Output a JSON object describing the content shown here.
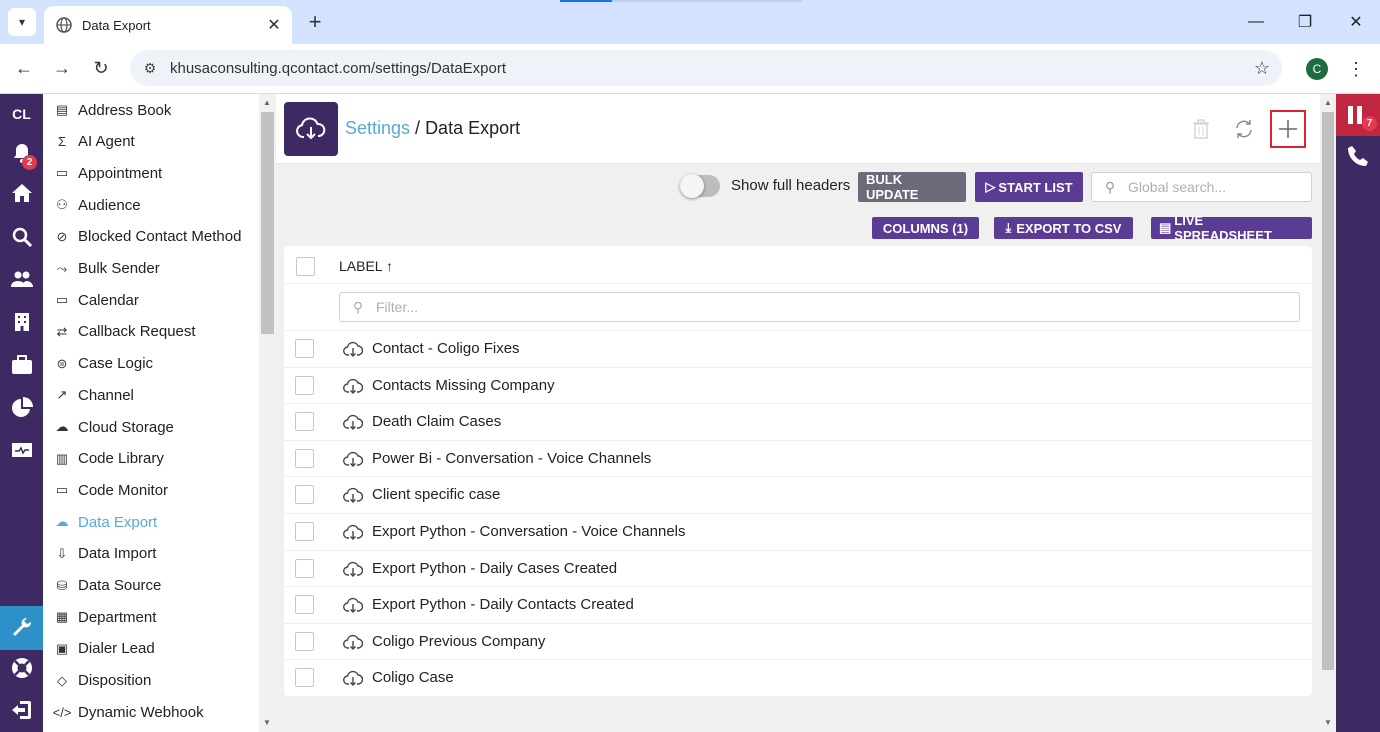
{
  "browser": {
    "tab_title": "Data Export",
    "url": "khusaconsulting.qcontact.com/settings/DataExport",
    "profile_initial": "C"
  },
  "rail": {
    "logo": "CL",
    "notification_count": "2",
    "items": [
      "bell-icon",
      "home-icon",
      "search-icon",
      "users-icon",
      "building-icon",
      "briefcase-icon",
      "pie-chart-icon",
      "monitor-icon",
      "wrench-icon",
      "lifebuoy-icon",
      "logout-icon"
    ]
  },
  "right_rail": {
    "queue_count": "7"
  },
  "menu": {
    "items": [
      {
        "label": "Address Book",
        "icon": "contact-card-icon",
        "glyph": "▤"
      },
      {
        "label": "AI Agent",
        "icon": "sigma-icon",
        "glyph": "Σ"
      },
      {
        "label": "Appointment",
        "icon": "calendar-icon",
        "glyph": "▭"
      },
      {
        "label": "Audience",
        "icon": "group-icon",
        "glyph": "⚇"
      },
      {
        "label": "Blocked Contact Method",
        "icon": "blocked-icon",
        "glyph": "⊘"
      },
      {
        "label": "Bulk Sender",
        "icon": "bulk-send-icon",
        "glyph": "⤳"
      },
      {
        "label": "Calendar",
        "icon": "calendar-icon",
        "glyph": "▭"
      },
      {
        "label": "Callback Request",
        "icon": "repeat-icon",
        "glyph": "⇄"
      },
      {
        "label": "Case Logic",
        "icon": "logic-icon",
        "glyph": "⊜"
      },
      {
        "label": "Channel",
        "icon": "external-link-icon",
        "glyph": "↗"
      },
      {
        "label": "Cloud Storage",
        "icon": "cloud-upload-icon",
        "glyph": "☁"
      },
      {
        "label": "Code Library",
        "icon": "books-icon",
        "glyph": "▥"
      },
      {
        "label": "Code Monitor",
        "icon": "code-monitor-icon",
        "glyph": "▭"
      },
      {
        "label": "Data Export",
        "icon": "cloud-download-icon",
        "glyph": "☁"
      },
      {
        "label": "Data Import",
        "icon": "import-icon",
        "glyph": "⇩"
      },
      {
        "label": "Data Source",
        "icon": "database-icon",
        "glyph": "⛁"
      },
      {
        "label": "Department",
        "icon": "building-icon",
        "glyph": "▦"
      },
      {
        "label": "Dialer Lead",
        "icon": "dialer-icon",
        "glyph": "▣"
      },
      {
        "label": "Disposition",
        "icon": "tag-icon",
        "glyph": "◇"
      },
      {
        "label": "Dynamic Webhook",
        "icon": "code-icon",
        "glyph": "</>"
      }
    ],
    "current": "Data Export"
  },
  "header": {
    "crumb_link": "Settings",
    "crumb_sep": " / ",
    "crumb_current": "Data Export"
  },
  "controls": {
    "toggle_label": "Show full headers",
    "bulk_update": "BULK UPDATE",
    "start_list": "START LIST",
    "search_placeholder": "Global search...",
    "columns": "COLUMNS (1)",
    "export_csv": "EXPORT TO CSV",
    "live_spreadsheet": "LIVE SPREADSHEET"
  },
  "table": {
    "column_label": "LABEL",
    "sort": "ascending",
    "filter_placeholder": "Filter...",
    "rows": [
      "Contact - Coligo Fixes",
      "Contacts Missing Company",
      "Death Claim Cases",
      "Power Bi - Conversation - Voice Channels",
      "Client specific case",
      "Export Python - Conversation - Voice Channels",
      "Export Python - Daily Cases Created",
      "Export Python - Daily Contacts Created",
      "Coligo Previous Company",
      "Coligo Case"
    ]
  },
  "colors": {
    "brand": "#3d2a63",
    "button": "#5b3c95",
    "link": "#5aa9d6",
    "highlight": "#e0202a"
  }
}
